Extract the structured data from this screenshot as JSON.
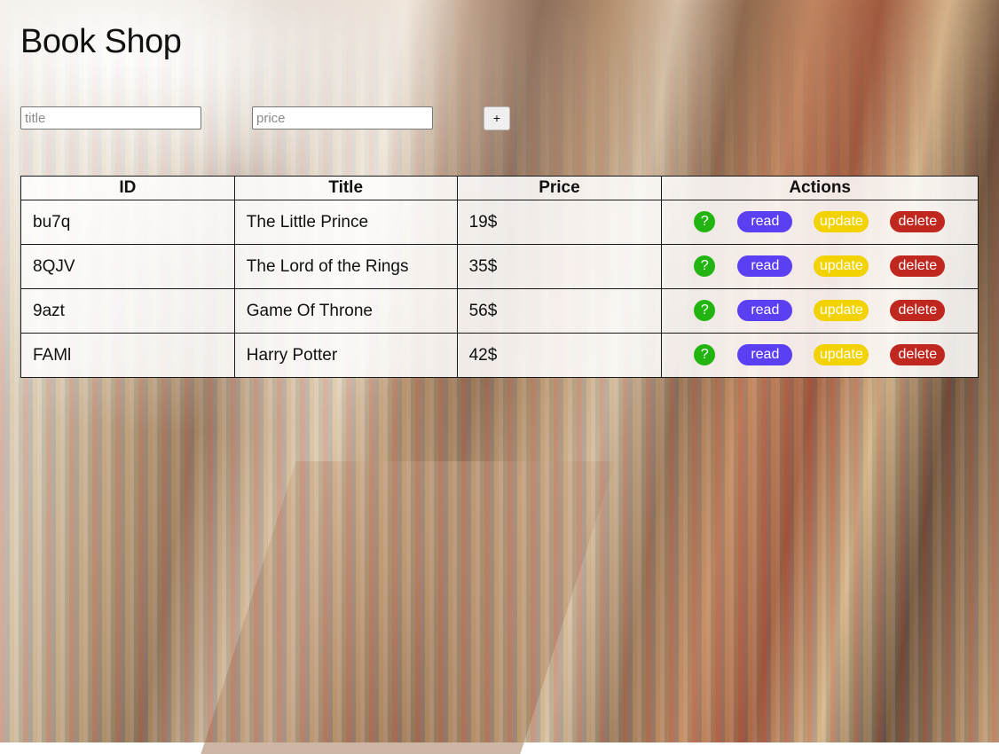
{
  "app": {
    "title": "Book Shop"
  },
  "form": {
    "title_placeholder": "title",
    "title_value": "",
    "price_placeholder": "price",
    "price_value": "",
    "add_label": "+"
  },
  "table": {
    "headers": [
      "ID",
      "Title",
      "Price",
      "Actions"
    ],
    "rows": [
      {
        "id": "bu7q",
        "title": "The Little Prince",
        "price": "19$"
      },
      {
        "id": "8QJV",
        "title": "The Lord of the Rings",
        "price": "35$"
      },
      {
        "id": "9azt",
        "title": "Game Of Throne",
        "price": "56$"
      },
      {
        "id": "FAMl",
        "title": "Harry Potter",
        "price": "42$"
      }
    ],
    "actions": {
      "help": "?",
      "read": "read",
      "update": "update",
      "delete": "delete"
    }
  },
  "colors": {
    "help": "#22b511",
    "read": "#5b3ff2",
    "update": "#f2d200",
    "delete": "#c0271f"
  }
}
